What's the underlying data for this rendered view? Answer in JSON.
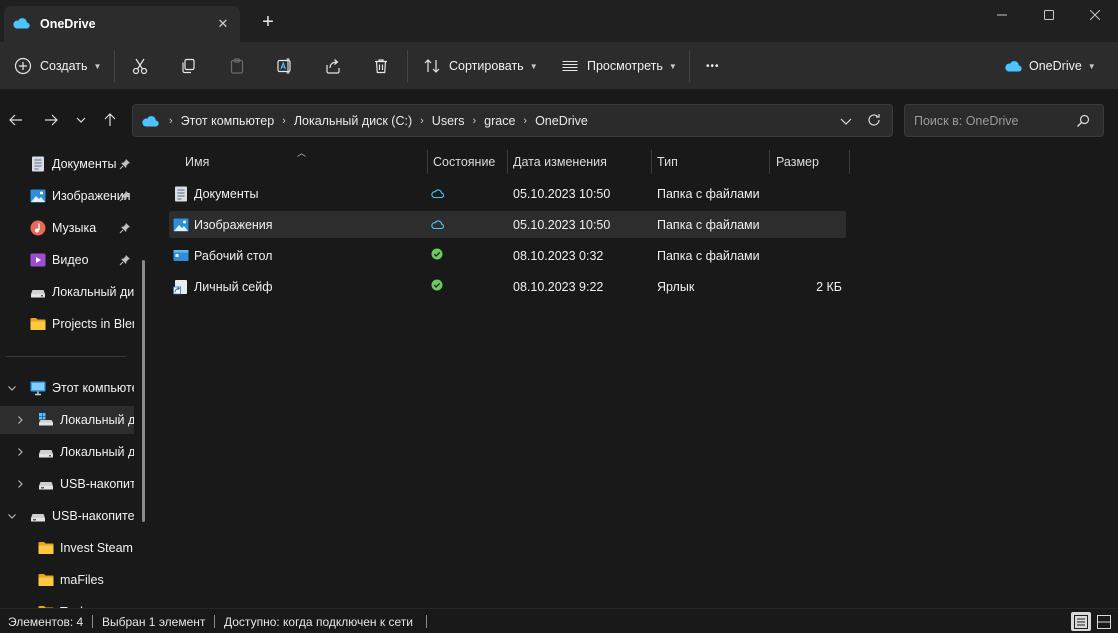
{
  "tab": {
    "title": "OneDrive",
    "close": "✕",
    "new_tab": "+"
  },
  "toolbar": {
    "create_label": "Создать",
    "sort_label": "Сортировать",
    "view_label": "Просмотреть",
    "more": "•••",
    "onedrive_label": "OneDrive"
  },
  "breadcrumb": [
    "Этот компьютер",
    "Локальный диск (C:)",
    "Users",
    "grace",
    "OneDrive"
  ],
  "breadcrumb_sep": "›",
  "search": {
    "placeholder": "Поиск в: OneDrive"
  },
  "sidebar": {
    "quick": [
      {
        "label": "Документы",
        "icon": "documents-icon",
        "pinned": true
      },
      {
        "label": "Изображения",
        "icon": "pictures-icon",
        "pinned": true
      },
      {
        "label": "Музыка",
        "icon": "music-icon",
        "pinned": true
      },
      {
        "label": "Видео",
        "icon": "video-icon",
        "pinned": true
      },
      {
        "label": "Локальный диск (C:)",
        "icon": "drive-icon",
        "pinned": false
      },
      {
        "label": "Projects in Blender",
        "icon": "folder-icon",
        "pinned": false
      }
    ],
    "tree": [
      {
        "label": "Этот компьютер",
        "icon": "computer-icon",
        "expander": "down"
      },
      {
        "label": "Локальный диск (C:)",
        "icon": "system-drive-icon",
        "expander": "right",
        "selected": true
      },
      {
        "label": "Локальный диск (D:)",
        "icon": "drive-icon",
        "expander": "right"
      },
      {
        "label": "USB-накопитель (E:)",
        "icon": "usb-drive-icon",
        "expander": "right"
      },
      {
        "label": "USB-накопитель (E:)",
        "icon": "usb-drive-icon",
        "expander": "down"
      },
      {
        "label": "Invest Steam",
        "icon": "folder-icon",
        "expander": ""
      },
      {
        "label": "maFiles",
        "icon": "folder-icon",
        "expander": ""
      },
      {
        "label": "Tools",
        "icon": "folder-icon",
        "expander": ""
      }
    ]
  },
  "columns": {
    "name": "Имя",
    "status": "Состояние",
    "date": "Дата изменения",
    "type": "Тип",
    "size": "Размер"
  },
  "files": [
    {
      "name": "Документы",
      "icon": "documents-icon",
      "status": "cloud-icon",
      "date": "05.10.2023 10:50",
      "type": "Папка с файлами",
      "size": ""
    },
    {
      "name": "Изображения",
      "icon": "pictures-icon",
      "status": "cloud-icon",
      "date": "05.10.2023 10:50",
      "type": "Папка с файлами",
      "size": "",
      "selected": true
    },
    {
      "name": "Рабочий стол",
      "icon": "desktop-icon",
      "status": "synced-check-icon",
      "date": "08.10.2023 0:32",
      "type": "Папка с файлами",
      "size": ""
    },
    {
      "name": "Личный сейф",
      "icon": "shortcut-icon",
      "status": "synced-check-icon",
      "date": "08.10.2023 9:22",
      "type": "Ярлык",
      "size": "2 КБ"
    }
  ],
  "statusbar": {
    "count": "Элементов: 4",
    "selected": "Выбран 1 элемент",
    "availability": "Доступно: когда подключен к сети"
  },
  "colors": {
    "accent": "#4cc2ff",
    "synced": "#6ccb5f",
    "folder": "#ffc83d",
    "background": "#191919"
  }
}
